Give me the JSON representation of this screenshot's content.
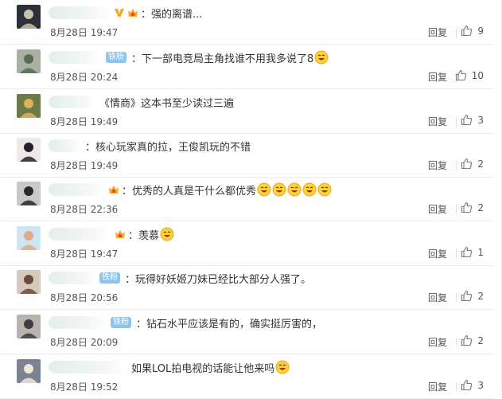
{
  "reply_label": "回复",
  "colors": {
    "accent": "#8cc4ee",
    "text": "#333333",
    "meta": "#555555"
  },
  "comments": [
    {
      "badge": "",
      "vip": true,
      "crown": true,
      "text": "：强的离谱...",
      "emojis": 0,
      "time": "8月28日 19:47",
      "likes": "9"
    },
    {
      "badge": "铁粉",
      "vip": false,
      "crown": false,
      "text": "：下一部电竞局主角找谁不用我多说了8",
      "emojis": 1,
      "time": "8月28日 20:24",
      "likes": "10"
    },
    {
      "badge": "",
      "vip": false,
      "crown": false,
      "text": "《情商》这本书至少读过三遍",
      "emojis": 0,
      "time": "8月28日 19:49",
      "likes": "3"
    },
    {
      "badge": "",
      "vip": false,
      "crown": false,
      "text": "：核心玩家真的拉，王俊凯玩的不错",
      "emojis": 0,
      "time": "8月28日 19:49",
      "likes": "2"
    },
    {
      "badge": "",
      "vip": false,
      "crown": true,
      "text": "：优秀的人真是干什么都优秀",
      "emojis": 5,
      "time": "8月28日 22:36",
      "likes": "2"
    },
    {
      "badge": "",
      "vip": false,
      "crown": true,
      "text": "：羡慕",
      "emojis": 1,
      "time": "8月28日 19:47",
      "likes": "1"
    },
    {
      "badge": "铁粉",
      "vip": false,
      "crown": false,
      "text": "：玩得好妖姬刀妹已经比大部分人强了。",
      "emojis": 0,
      "time": "8月28日 20:56",
      "likes": "2"
    },
    {
      "badge": "铁粉",
      "vip": false,
      "crown": false,
      "text": "：钻石水平应该是有的，确实挺厉害的，",
      "emojis": 0,
      "time": "8月28日 20:09",
      "likes": "2"
    },
    {
      "badge": "",
      "vip": false,
      "crown": false,
      "text": "如果LOL拍电视的话能让他来吗",
      "emojis": 1,
      "time": "8月28日 19:52",
      "likes": "3"
    }
  ]
}
